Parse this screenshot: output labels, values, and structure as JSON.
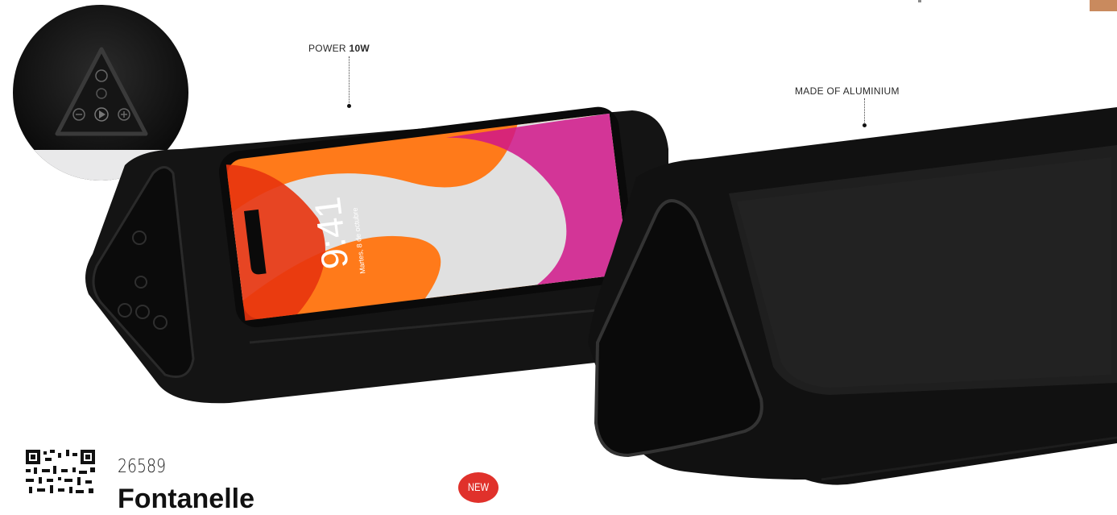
{
  "callouts": {
    "power": {
      "prefix": "POWER ",
      "value": "10W"
    },
    "material": {
      "text": "MADE OF ALUMINIUM"
    }
  },
  "phone": {
    "time": "9:41",
    "date": "Martes, 8 de octubre"
  },
  "product": {
    "code": "26589",
    "name": "Fontanelle",
    "badge": "NEW"
  },
  "colors": {
    "accent": "#c98a5e",
    "badge": "#e0312b",
    "body": "#111111"
  },
  "icons": [
    "power-icon",
    "play-icon",
    "minus-icon",
    "plus-icon",
    "lock-icon",
    "qr-code-icon"
  ]
}
